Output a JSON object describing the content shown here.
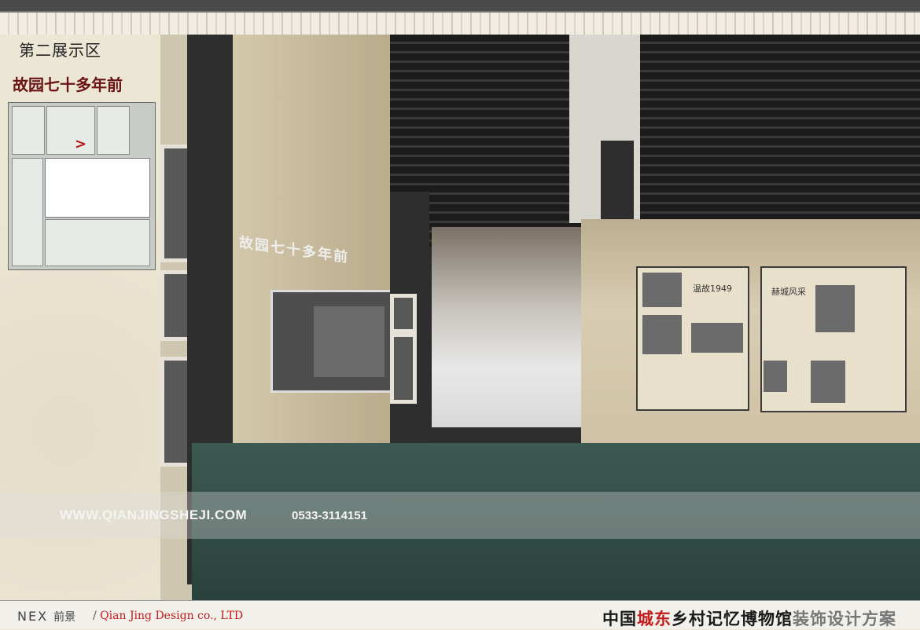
{
  "header": {
    "zone_label": "第二展示区",
    "section_title": "故园七十多年前"
  },
  "scene": {
    "exhibit_title": "故园七十多年前",
    "board_middle_title": "温故1949",
    "board_right_title": "赫城风采"
  },
  "watermark": {
    "url": "WWW.QIANJINGSHEJI.COM",
    "phone": "0533-3114151"
  },
  "footer": {
    "logo_text": "NEX",
    "logo_cn": "前景",
    "company": "Qian Jing Design co., LTD",
    "title_part1": "中国",
    "title_part2": "城东",
    "title_part3": "乡村记忆博物馆",
    "title_part4": "装饰设计方案"
  },
  "colors": {
    "accent_red": "#c21b1b",
    "section_title": "#6b1414",
    "floor_green": "#2f4842"
  }
}
